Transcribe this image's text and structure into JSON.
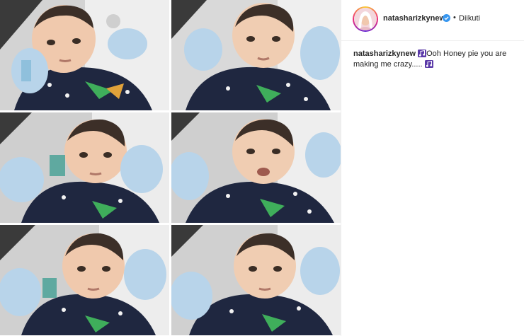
{
  "post": {
    "image_alt": "Collage of six photos of a baby",
    "tiles": 6
  },
  "header": {
    "username": "natasharizkynew",
    "separator": "•",
    "follow_status": "Diikuti"
  },
  "caption": {
    "username": "natasharizkynew",
    "text_part1": "Ooh Honey pie you are making me crazy.....",
    "emoji_icon": "musical-notes-icon"
  },
  "colors": {
    "verified": "#3897f0",
    "text": "#262626",
    "border": "#efefef",
    "emoji": "#5b3aa8"
  }
}
